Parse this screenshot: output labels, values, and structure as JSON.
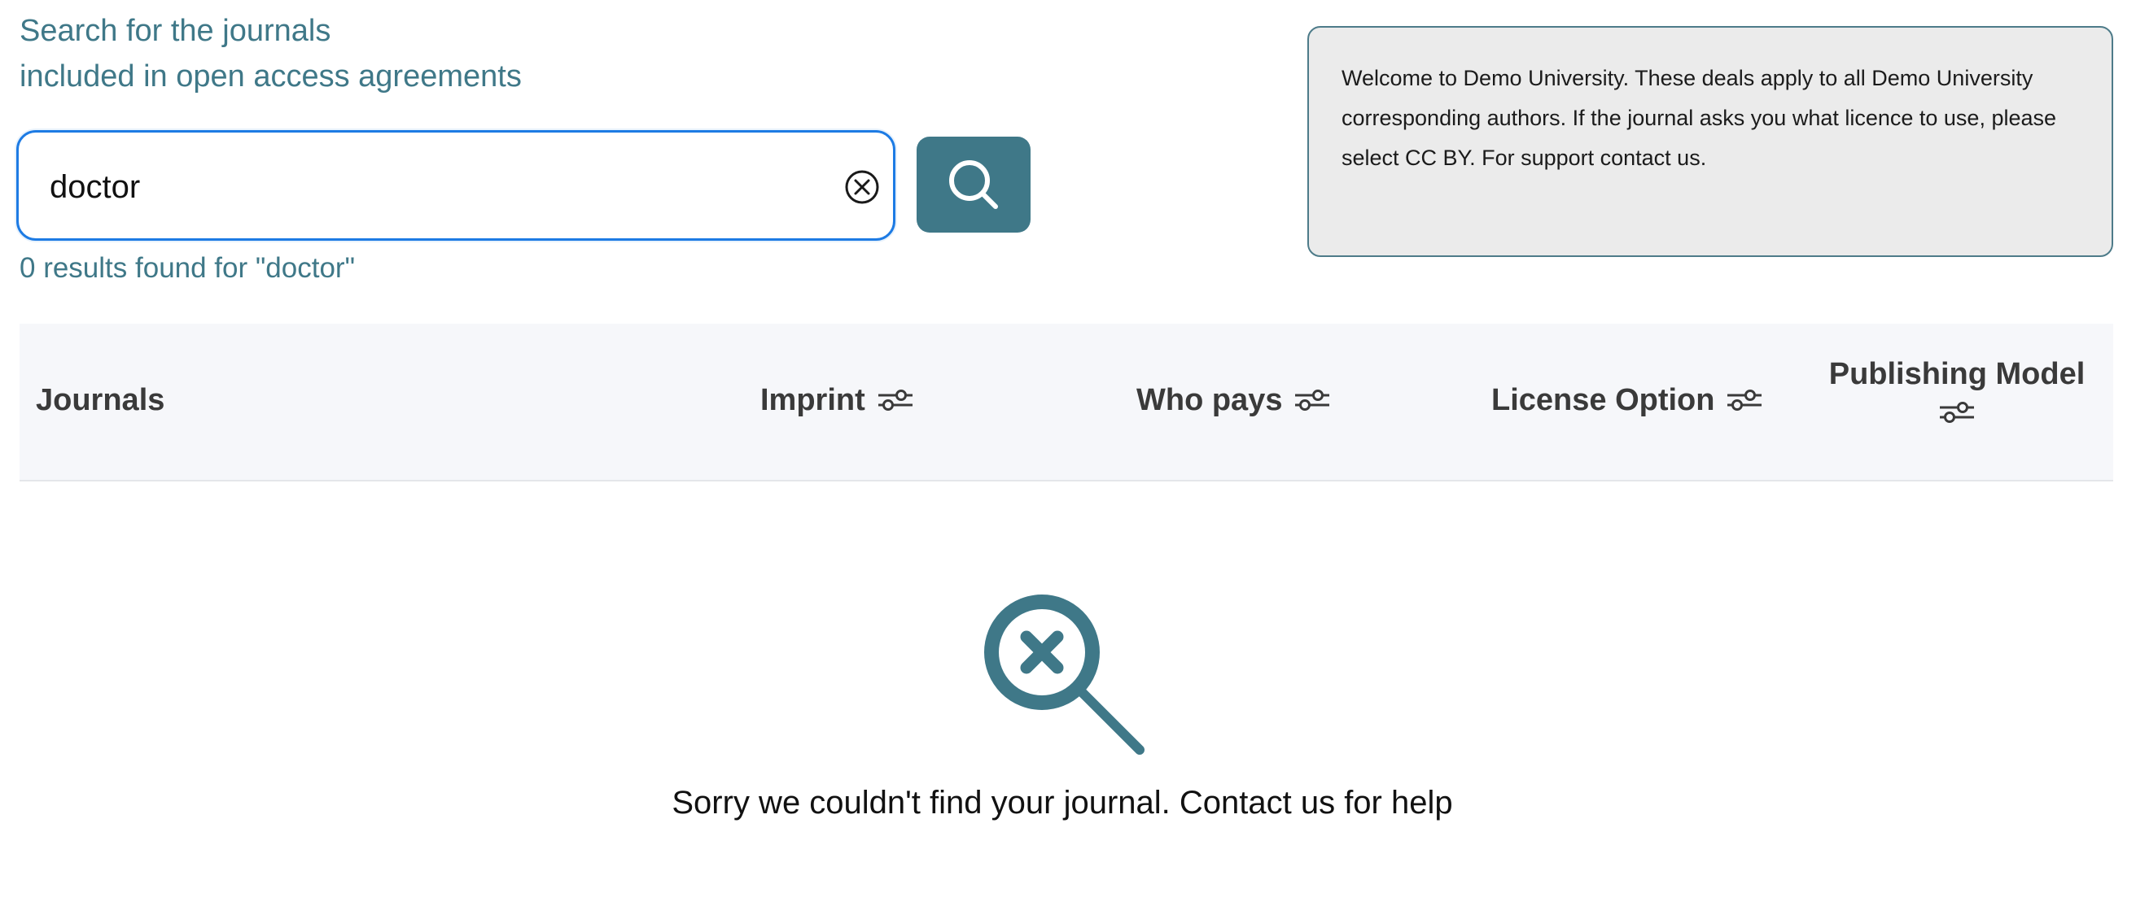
{
  "heading": {
    "line1": "Search for the journals",
    "line2": "included in open access agreements"
  },
  "search": {
    "value": "doctor",
    "clear_icon": "clear-circle-x-icon",
    "button_icon": "magnifier-icon"
  },
  "results": {
    "count_text": "0 results found for \"doctor\""
  },
  "welcome": {
    "text": "Welcome to Demo University. These deals apply to all Demo University corresponding authors. If the journal asks you what licence to use, please select CC BY. For support contact us."
  },
  "table": {
    "columns": [
      {
        "label": "Journals"
      },
      {
        "label": "Imprint"
      },
      {
        "label": "Who pays"
      },
      {
        "label": "License Option"
      },
      {
        "label": "Publishing Model"
      }
    ],
    "filter_icon": "filter-sliders-icon"
  },
  "empty_state": {
    "icon": "magnifier-x-icon",
    "message": "Sorry we couldn't find your journal. Contact us for help"
  },
  "colors": {
    "accent": "#3f7888",
    "focus_border": "#1d7be4",
    "panel_bg": "#ebebeb",
    "header_bg": "#f6f7fa"
  }
}
